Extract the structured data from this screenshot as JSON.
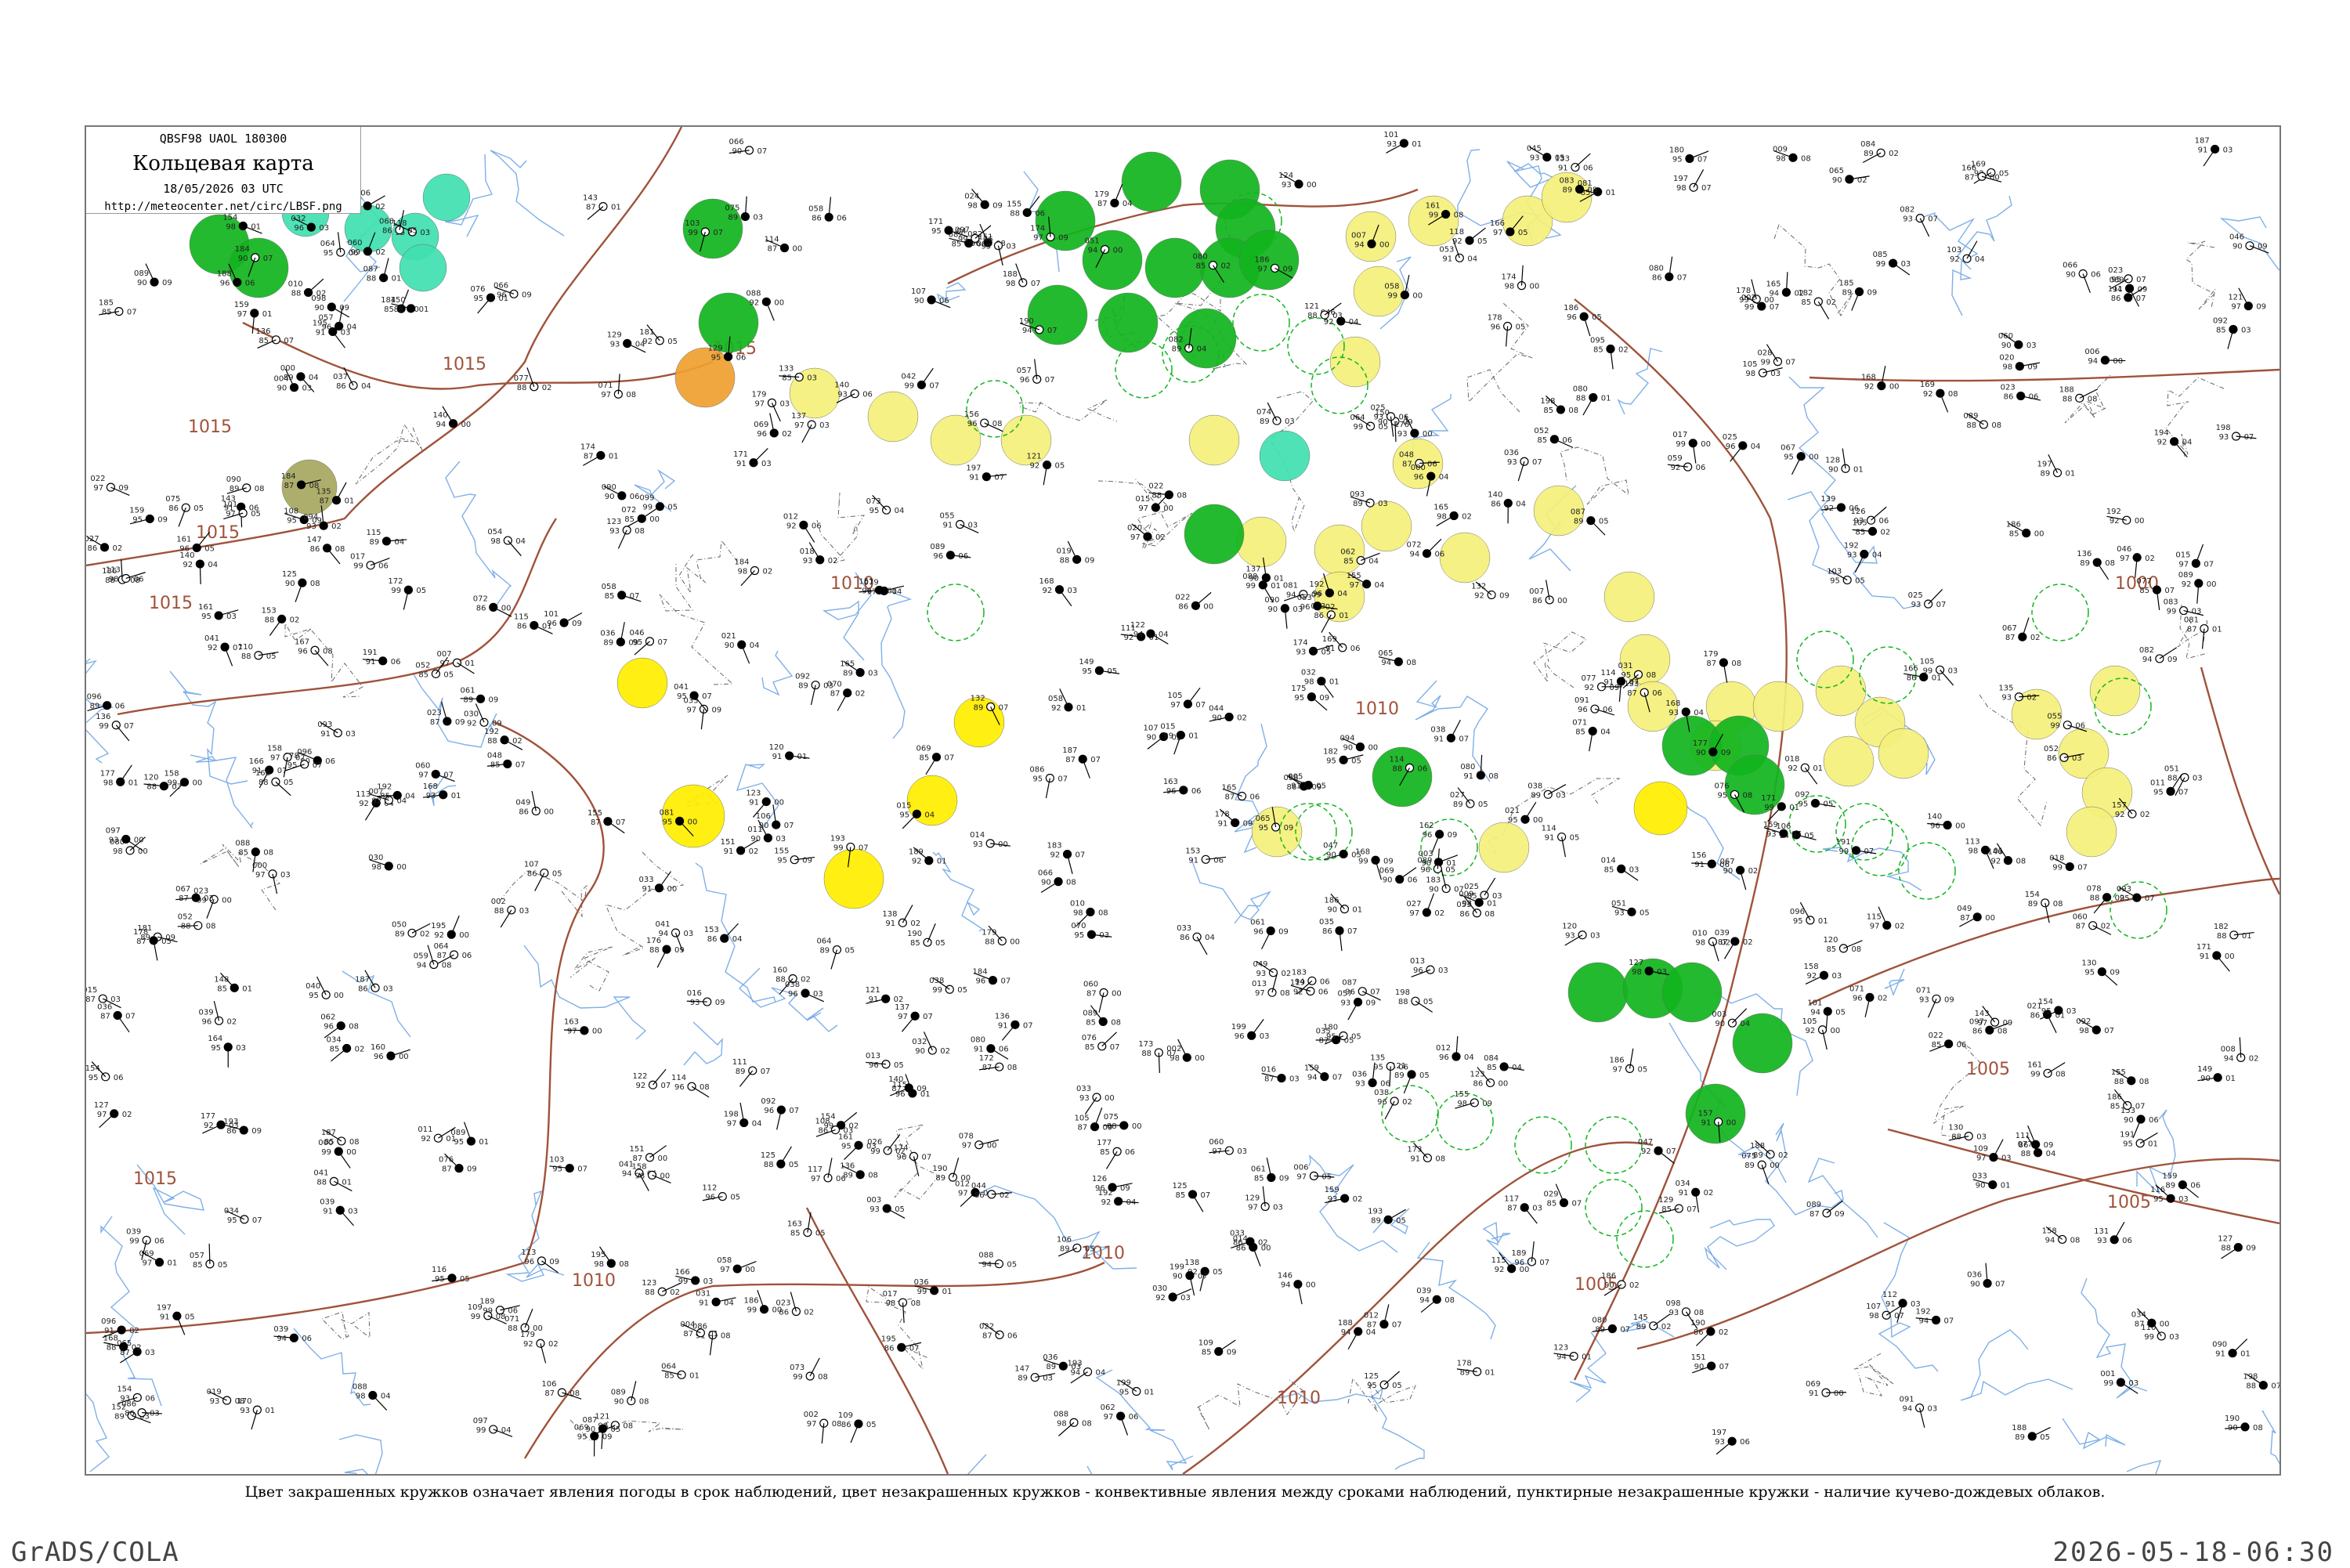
{
  "title_box": {
    "code": "QBSF98  UAOL  180300",
    "name": "Кольцевая карта",
    "date": "18/05/2026 03 UTC",
    "url": "http://meteocenter.net/circ/LBSF.png"
  },
  "legend": "Цвет закрашенных кружков означает явления погоды в срок наблюдений, цвет незакрашенных кружков - конвективные явления между сроками наблюдений, пунктирные незакрашенные кружки - наличие кучево-дождевых облаков.",
  "footer": {
    "left": "GrADS/COLA",
    "right": "2026-05-18-06:30"
  },
  "colors": {
    "isobar": "#a0523a",
    "river": "#7fb0e8",
    "border": "#666666",
    "rain": "#12b51e",
    "shower_dashed": "#12b51e",
    "fog": "#f5f07a",
    "drizzle": "#ffee00",
    "haze": "#f0a030",
    "snow": "#40e0b0",
    "dust": "#a8a860"
  },
  "isobar_labels": [
    "1015",
    "1015",
    "1015",
    "1015",
    "1015",
    "1015",
    "1010",
    "1010",
    "1010",
    "1010",
    "1010",
    "1005",
    "1005",
    "1005",
    "1005",
    "1000"
  ],
  "stations": [
    {
      "name": "Rain",
      "marker": "rain",
      "t": "97",
      "p": "04"
    },
    {
      "name": "Fog",
      "marker": "fog",
      "t": "96",
      "p": "01"
    }
  ]
}
